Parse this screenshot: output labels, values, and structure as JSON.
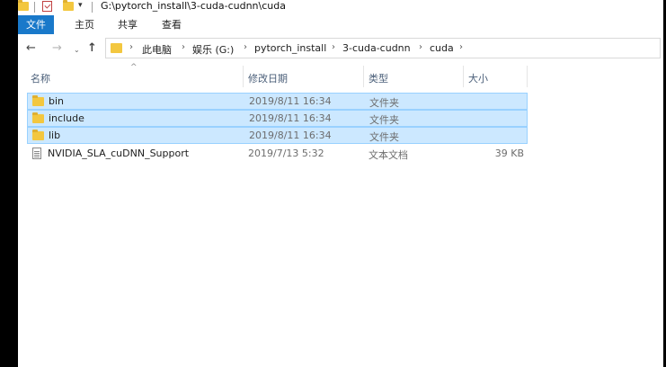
{
  "window": {
    "title_path": "G:\\pytorch_install\\3-cuda-cudnn\\cuda",
    "quick_access_dropdown": "▾"
  },
  "ribbon": {
    "tabs": [
      "文件",
      "主页",
      "共享",
      "查看"
    ]
  },
  "nav": {
    "back": "←",
    "forward": "→",
    "recent": "⌄",
    "up": "↑",
    "separator": "›",
    "breadcrumb": [
      "此电脑",
      "娱乐 (G:)",
      "pytorch_install",
      "3-cuda-cudnn",
      "cuda"
    ]
  },
  "columns": {
    "sort_indicator": "^",
    "name": "名称",
    "date": "修改日期",
    "type": "类型",
    "size": "大小"
  },
  "files": [
    {
      "name": "bin",
      "date": "2019/8/11 16:34",
      "type": "文件夹",
      "size": "",
      "icon": "folder-icon",
      "selected": true
    },
    {
      "name": "include",
      "date": "2019/8/11 16:34",
      "type": "文件夹",
      "size": "",
      "icon": "folder-icon",
      "selected": true
    },
    {
      "name": "lib",
      "date": "2019/8/11 16:34",
      "type": "文件夹",
      "size": "",
      "icon": "folder-icon",
      "selected": true
    },
    {
      "name": "NVIDIA_SLA_cuDNN_Support",
      "date": "2019/7/13 5:32",
      "type": "文本文档",
      "size": "39 KB",
      "icon": "text-document-icon",
      "selected": false
    }
  ],
  "colors": {
    "file_tab_bg": "#1979ca",
    "selection_bg": "#cce8ff",
    "selection_border": "#99d1ff",
    "folder_yellow": "#f3c73f"
  }
}
